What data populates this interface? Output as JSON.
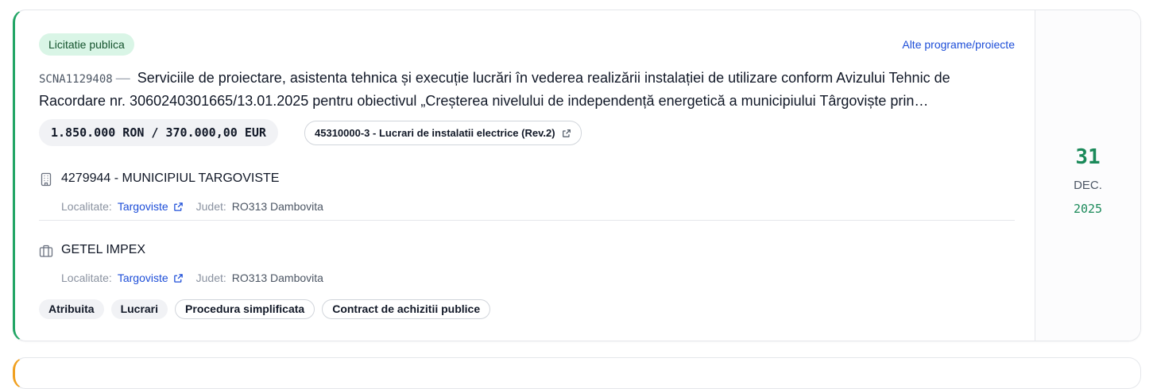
{
  "notice": {
    "type_badge": "Licitatie publica",
    "other_link": "Alte programe/proiecte",
    "code": "SCNA1129408",
    "separator": "—",
    "title": "Serviciile de proiectare, asistenta tehnica și execuție lucrări în vederea realizării instalației de utilizare conform Avizului Tehnic de Racordare nr. 3060240301665/13.01.2025 pentru obiectivul „Creșterea nivelului de independență energetică a municipiului Târgoviște prin…",
    "value": "1.850.000 RON / 370.000,00 EUR",
    "cpv": "45310000-3 - Lucrari de instalatii electrice (Rev.2)"
  },
  "authority": {
    "name": "4279944 - MUNICIPIUL TARGOVISTE",
    "icon": "building-icon",
    "locality_label": "Localitate:",
    "locality": "Targoviste",
    "county_label": "Judet:",
    "county": "RO313 Dambovita"
  },
  "winner": {
    "name": "GETEL IMPEX",
    "icon": "briefcase-icon",
    "locality_label": "Localitate:",
    "locality": "Targoviste",
    "county_label": "Judet:",
    "county": "RO313 Dambovita"
  },
  "tags": [
    "Atribuita",
    "Lucrari",
    "Procedura simplificata",
    "Contract de achizitii publice"
  ],
  "date": {
    "day": "31",
    "month": "DEC.",
    "year": "2025"
  },
  "colors": {
    "accent_green": "#22a565",
    "next_card_accent": "#f0a020",
    "link_blue": "#1d4ed8"
  }
}
